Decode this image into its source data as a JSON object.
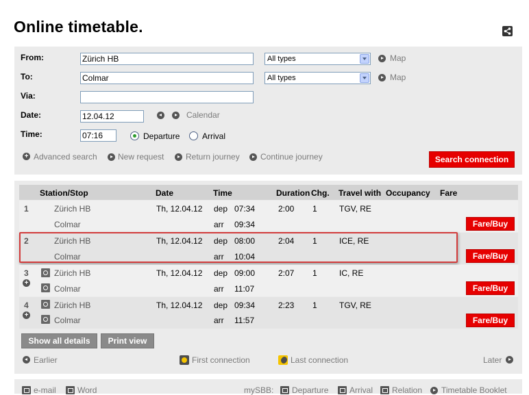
{
  "page": {
    "title": "Online timetable."
  },
  "header": {
    "share_icon": "share-icon"
  },
  "search": {
    "from_label": "From:",
    "from_value": "Zürich HB",
    "from_type": "All types",
    "from_map": "Map",
    "to_label": "To:",
    "to_value": "Colmar",
    "to_type": "All types",
    "to_map": "Map",
    "via_label": "Via:",
    "via_value": "",
    "date_label": "Date:",
    "date_value": "12.04.12",
    "calendar_label": "Calendar",
    "time_label": "Time:",
    "time_value": "07:16",
    "departure_label": "Departure",
    "arrival_label": "Arrival",
    "selected_mode": "Departure",
    "advanced_search": "Advanced search",
    "new_request": "New request",
    "return_journey": "Return journey",
    "continue_journey": "Continue journey",
    "search_button": "Search connection"
  },
  "results": {
    "columns": {
      "station": "Station/Stop",
      "date": "Date",
      "time": "Time",
      "duration": "Duration",
      "changes": "Chg.",
      "travel_with": "Travel with",
      "occupancy": "Occupancy",
      "fare": "Fare"
    },
    "rows": [
      {
        "num": "1",
        "from": "Zürich HB",
        "to": "Colmar",
        "date": "Th, 12.04.12",
        "dep_label": "dep",
        "dep": "07:34",
        "arr_label": "arr",
        "arr": "09:34",
        "duration": "2:00",
        "changes": "1",
        "travel_with": "TGV, RE",
        "fare_button": "Fare/Buy"
      },
      {
        "num": "2",
        "from": "Zürich HB",
        "to": "Colmar",
        "date": "Th, 12.04.12",
        "dep_label": "dep",
        "dep": "08:00",
        "arr_label": "arr",
        "arr": "10:04",
        "duration": "2:04",
        "changes": "1",
        "travel_with": "ICE, RE",
        "fare_button": "Fare/Buy"
      },
      {
        "num": "3",
        "from": "Zürich HB",
        "to": "Colmar",
        "date": "Th, 12.04.12",
        "dep_label": "dep",
        "dep": "09:00",
        "arr_label": "arr",
        "arr": "11:07",
        "duration": "2:07",
        "changes": "1",
        "travel_with": "IC, RE",
        "fare_button": "Fare/Buy"
      },
      {
        "num": "4",
        "from": "Zürich HB",
        "to": "Colmar",
        "date": "Th, 12.04.12",
        "dep_label": "dep",
        "dep": "09:34",
        "arr_label": "arr",
        "arr": "11:57",
        "duration": "2:23",
        "changes": "1",
        "travel_with": "TGV, RE",
        "fare_button": "Fare/Buy"
      }
    ],
    "show_all_details": "Show all details",
    "print_view": "Print view",
    "earlier": "Earlier",
    "first_connection": "First connection",
    "last_connection": "Last connection",
    "later": "Later"
  },
  "footer": {
    "email": "e-mail",
    "word": "Word",
    "mysbb": "mySBB:",
    "departure": "Departure",
    "arrival": "Arrival",
    "relation": "Relation",
    "timetable_booklet": "Timetable Booklet"
  },
  "colors": {
    "accent_red": "#e60000",
    "panel_grey": "#ebebeb",
    "header_grey": "#d2d2d2",
    "highlight_box": "#d23b3b"
  }
}
